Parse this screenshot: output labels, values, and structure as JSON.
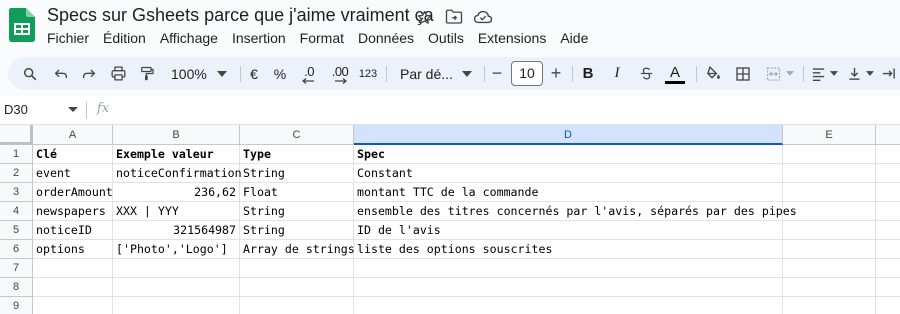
{
  "document": {
    "title": "Specs sur Gsheets parce que j'aime vraiment ça"
  },
  "menu": [
    "Fichier",
    "Édition",
    "Affichage",
    "Insertion",
    "Format",
    "Données",
    "Outils",
    "Extensions",
    "Aide"
  ],
  "toolbar": {
    "zoom": "100%",
    "currency": "€",
    "percent": "%",
    "decrease_decimals": ".0",
    "increase_decimals": ".00",
    "more_formats": "123",
    "font": "Par dé...",
    "font_size": "10",
    "minus": "−",
    "plus": "+",
    "bold": "B",
    "italic": "I",
    "text_color_letter": "A",
    "text_color_bar": "#000000"
  },
  "formula_bar": {
    "cell_ref": "D30",
    "fx": "fx",
    "value": ""
  },
  "columns": [
    "A",
    "B",
    "C",
    "D",
    "E"
  ],
  "selected_column": "D",
  "rows": [
    {
      "num": "1",
      "cells": [
        "Clé",
        "Exemple valeur",
        "Type",
        "Spec",
        ""
      ]
    },
    {
      "num": "2",
      "cells": [
        "event",
        "noticeConfirmation",
        "String",
        "Constant",
        ""
      ]
    },
    {
      "num": "3",
      "cells": [
        "orderAmount",
        "236,62",
        "Float",
        "montant TTC de la commande",
        ""
      ]
    },
    {
      "num": "4",
      "cells": [
        "newspapers",
        "XXX | YYY",
        "String",
        "ensemble des titres concernés par l'avis, séparés par des pipes",
        ""
      ]
    },
    {
      "num": "5",
      "cells": [
        "noticeID",
        "321564987",
        "String",
        "ID de l'avis",
        ""
      ]
    },
    {
      "num": "6",
      "cells": [
        "options",
        "['Photo','Logo']",
        "Array de strings",
        "liste des options souscrites",
        ""
      ]
    },
    {
      "num": "7",
      "cells": [
        "",
        "",
        "",
        "",
        ""
      ]
    },
    {
      "num": "8",
      "cells": [
        "",
        "",
        "",
        "",
        ""
      ]
    },
    {
      "num": "9",
      "cells": [
        "",
        "",
        "",
        "",
        ""
      ]
    }
  ],
  "colors": {
    "sheets_green": "#0f9d58",
    "selection_blue": "#0b57d0",
    "selection_header_bg": "#d3e3fd"
  }
}
